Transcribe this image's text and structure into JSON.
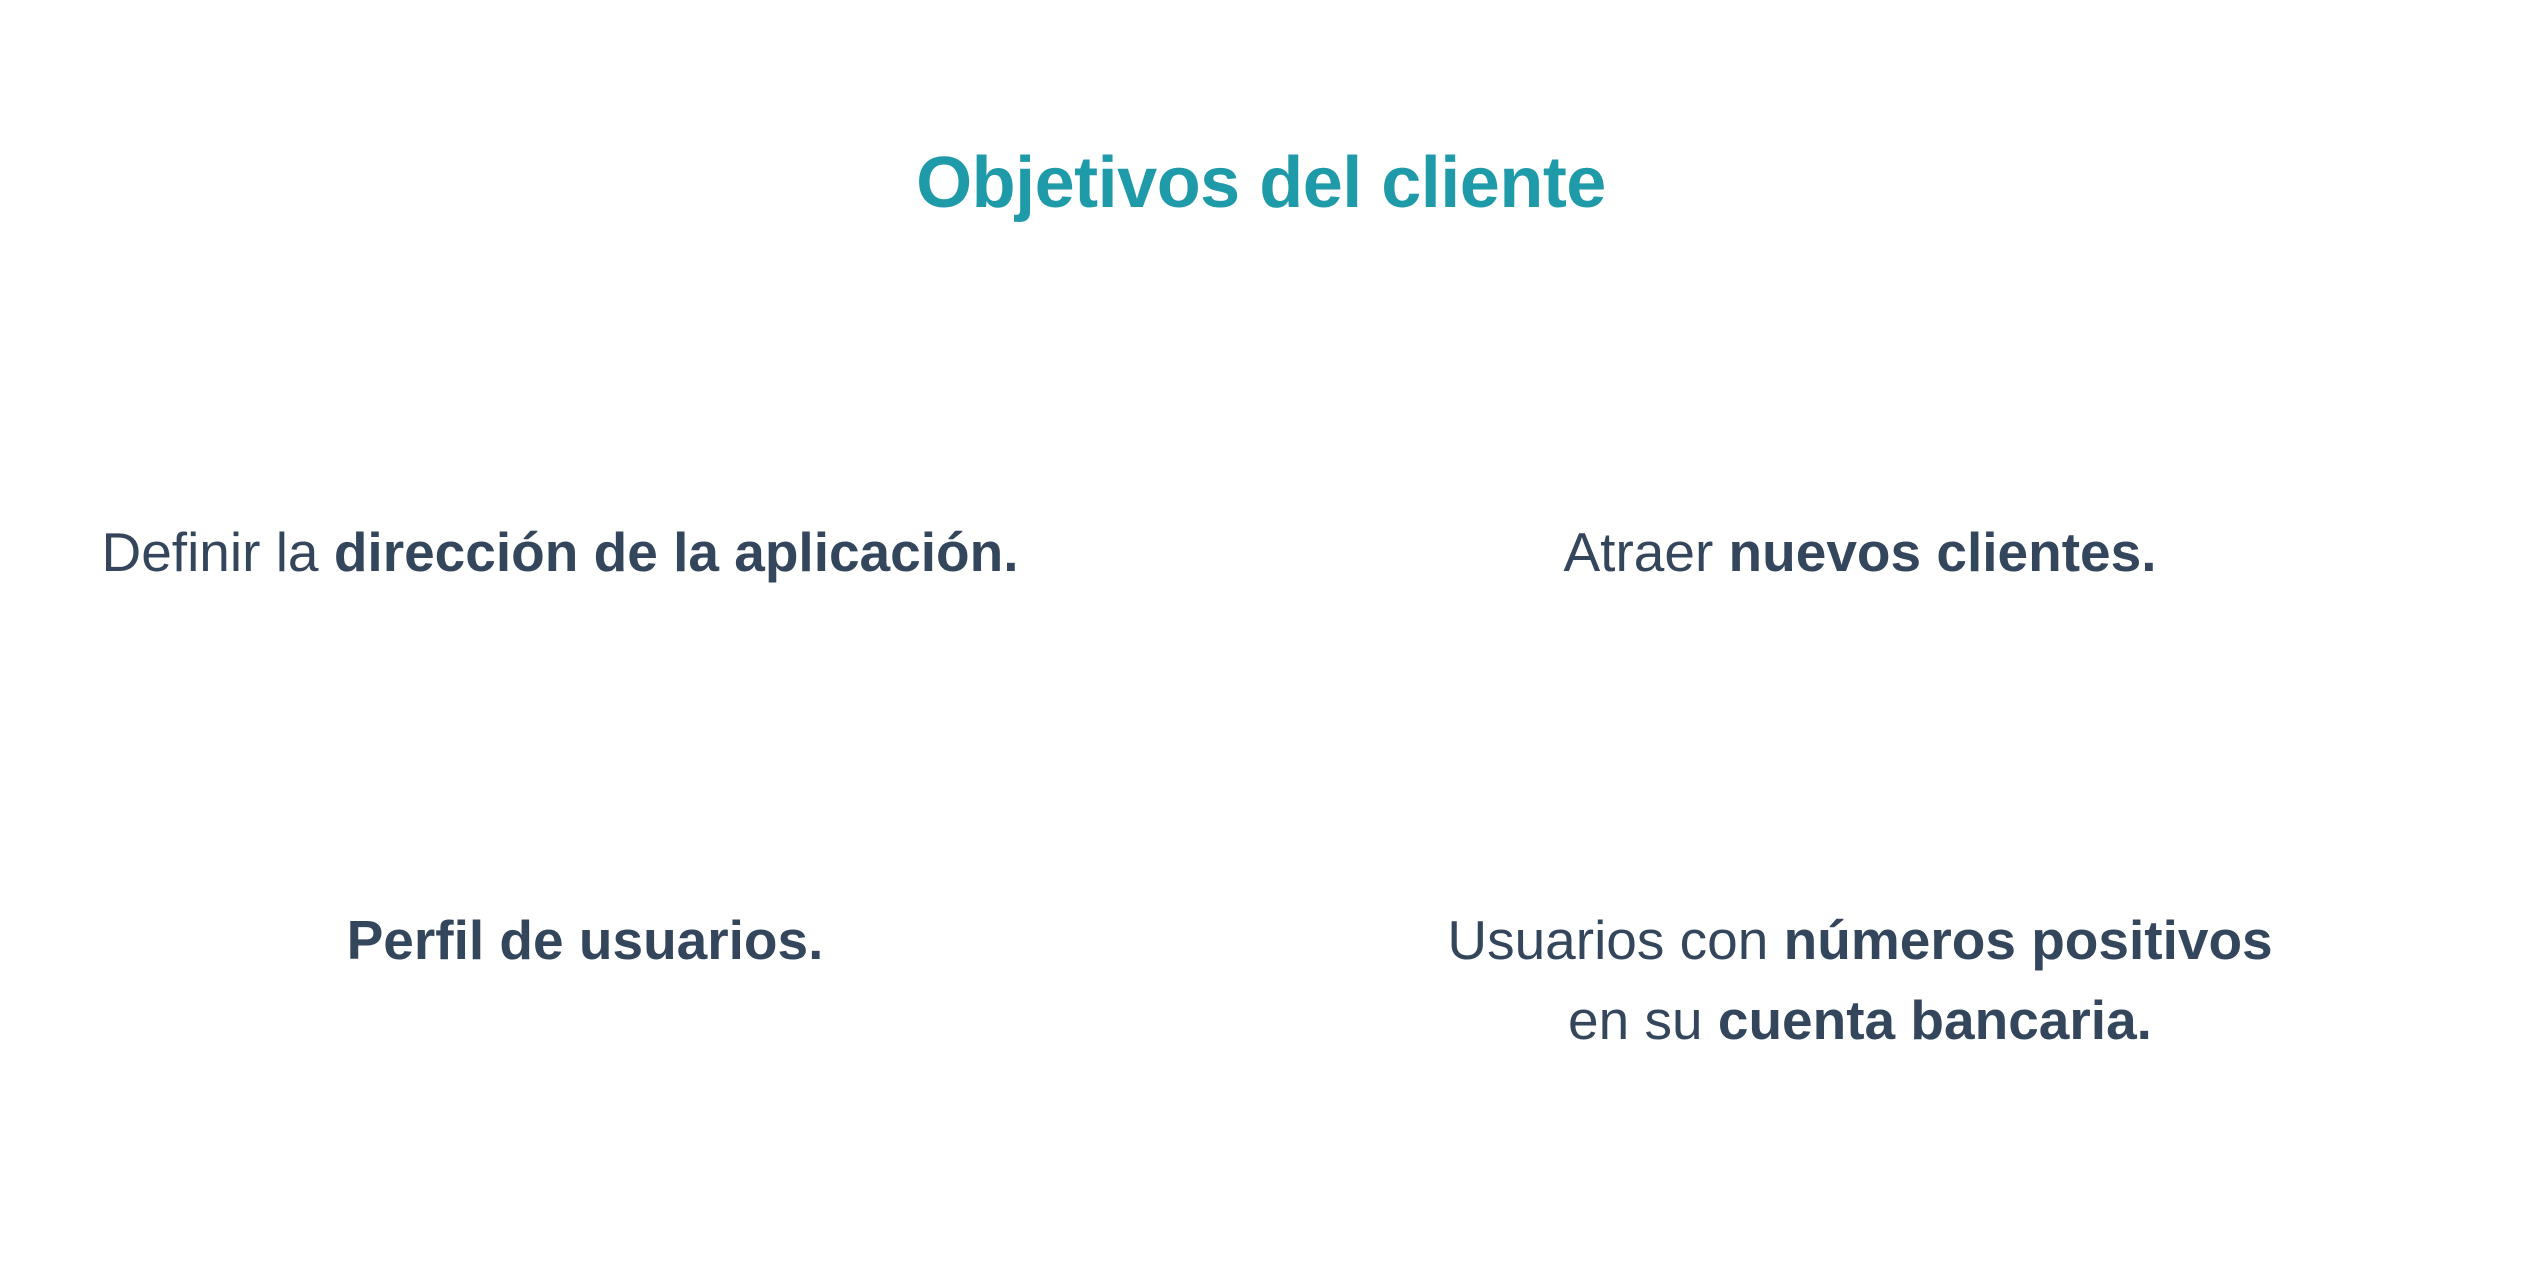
{
  "title": "Objetivos del cliente",
  "colors": {
    "title": "#1f9aa8",
    "text": "#34465c",
    "background": "#ffffff"
  },
  "goals": [
    {
      "light": "Definir la ",
      "bold": "dirección de la aplicación."
    },
    {
      "light": "Atraer ",
      "bold": "nuevos clientes."
    },
    {
      "light": "",
      "bold": "Perfil de usuarios."
    },
    {
      "line1_light": "Usuarios con ",
      "line1_bold": "números positivos",
      "line2_light": "en su ",
      "line2_bold": "cuenta bancaria."
    }
  ]
}
